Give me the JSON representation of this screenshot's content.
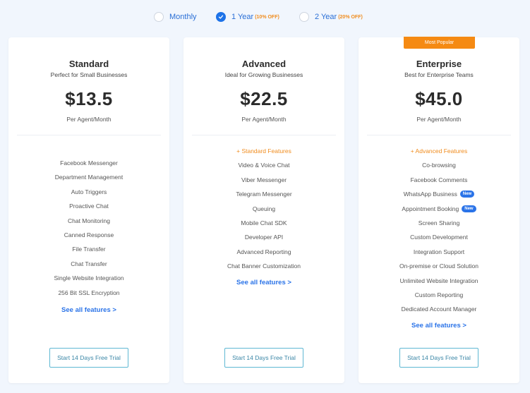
{
  "billing": {
    "options": [
      {
        "label": "Monthly",
        "discount": "",
        "selected": false
      },
      {
        "label": "1 Year",
        "discount": "(10% OFF)",
        "selected": true
      },
      {
        "label": "2 Year",
        "discount": "(20% OFF)",
        "selected": false
      }
    ]
  },
  "badge": "Most Popular",
  "plans": [
    {
      "name": "Standard",
      "subtitle": "Perfect for Small Businesses",
      "price": "$13.5",
      "per": "Per Agent/Month",
      "features": [
        "Facebook Messenger",
        "Department Management",
        "Auto Triggers",
        "Proactive Chat",
        "Chat Monitoring",
        "Canned Response",
        "File Transfer",
        "Chat Transfer",
        "Single Website Integration",
        "256 Bit SSL Encryption"
      ],
      "see_all": "See all features >",
      "cta": "Start 14 Days Free Trial"
    },
    {
      "name": "Advanced",
      "subtitle": "Ideal for Growing Businesses",
      "price": "$22.5",
      "per": "Per Agent/Month",
      "includes": "+ Standard Features",
      "features": [
        "Video & Voice Chat",
        "Viber Messenger",
        "Telegram Messenger",
        "Queuing",
        "Mobile Chat SDK",
        "Developer API",
        "Advanced Reporting",
        "Chat Banner Customization"
      ],
      "see_all": "See all features >",
      "cta": "Start 14 Days Free Trial"
    },
    {
      "name": "Enterprise",
      "subtitle": "Best for Enterprise Teams",
      "price": "$45.0",
      "per": "Per Agent/Month",
      "includes": "+ Advanced Features",
      "features": [
        "Co-browsing",
        "Facebook Comments",
        "WhatsApp Business",
        "Appointment Booking",
        "Screen Sharing",
        "Custom Development",
        "Integration Support",
        "On-premise or Cloud Solution",
        "Unlimited Website Integration",
        "Custom Reporting",
        "Dedicated Account Manager"
      ],
      "new_tag": "New",
      "see_all": "See all features >",
      "cta": "Start 14 Days Free Trial"
    }
  ],
  "colors": {
    "accent_blue": "#2a73e8",
    "accent_orange": "#f58a13",
    "background": "#f1f6fd"
  }
}
